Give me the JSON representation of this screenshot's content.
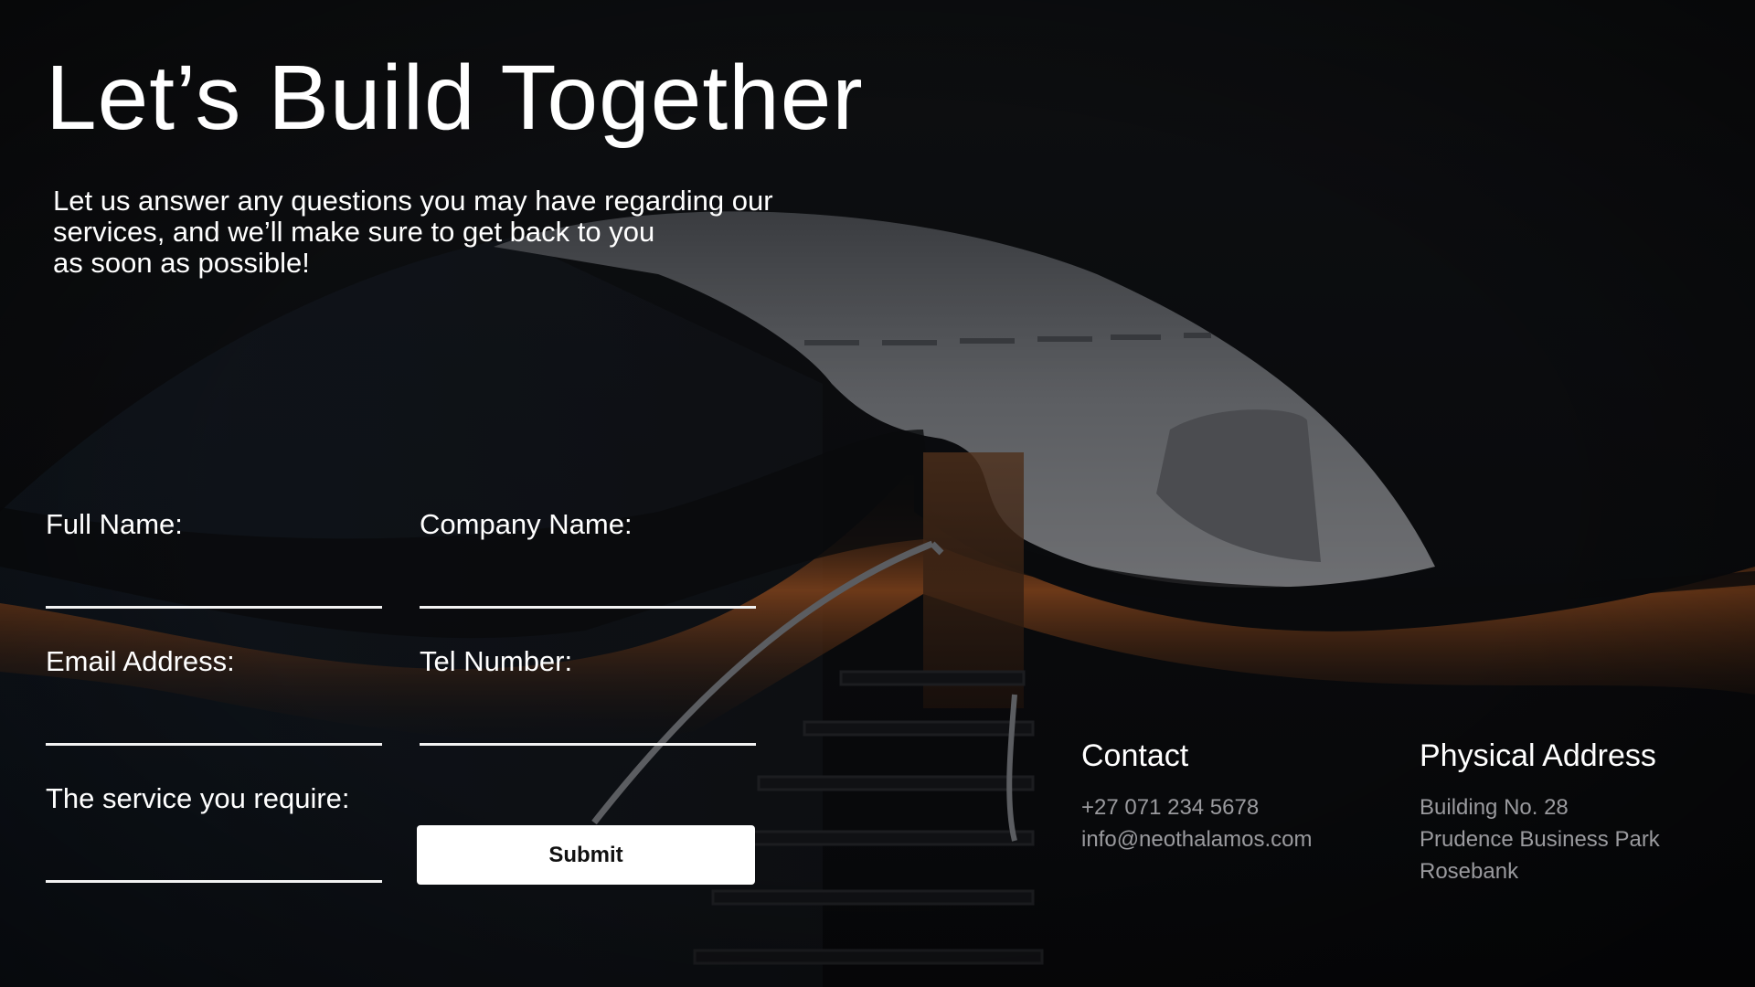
{
  "hero": {
    "title": "Let’s Build Together",
    "subtitle_lines": [
      "Let us answer any questions you may have regarding our",
      "services, and we’ll make sure to get back to you",
      "as soon as possible!"
    ]
  },
  "form": {
    "full_name_label": "Full Name:",
    "company_name_label": "Company Name:",
    "email_label": "Email Address:",
    "tel_label": "Tel Number:",
    "service_label": "The service you require:",
    "full_name_value": "",
    "company_name_value": "",
    "email_value": "",
    "tel_value": "",
    "service_value": "",
    "submit_label": "Submit"
  },
  "contact": {
    "heading": "Contact",
    "phone": "+27 071 234 5678",
    "email": "info@neothalamos.com"
  },
  "address": {
    "heading": "Physical Address",
    "lines": [
      "Building No. 28",
      "Prudence Business Park",
      "Rosebank"
    ]
  },
  "colors": {
    "background": "#0e0f12",
    "text": "#ffffff",
    "muted_text": "#9a9a9e",
    "accent_glow": "#c2652a",
    "button": "#ffffff"
  }
}
